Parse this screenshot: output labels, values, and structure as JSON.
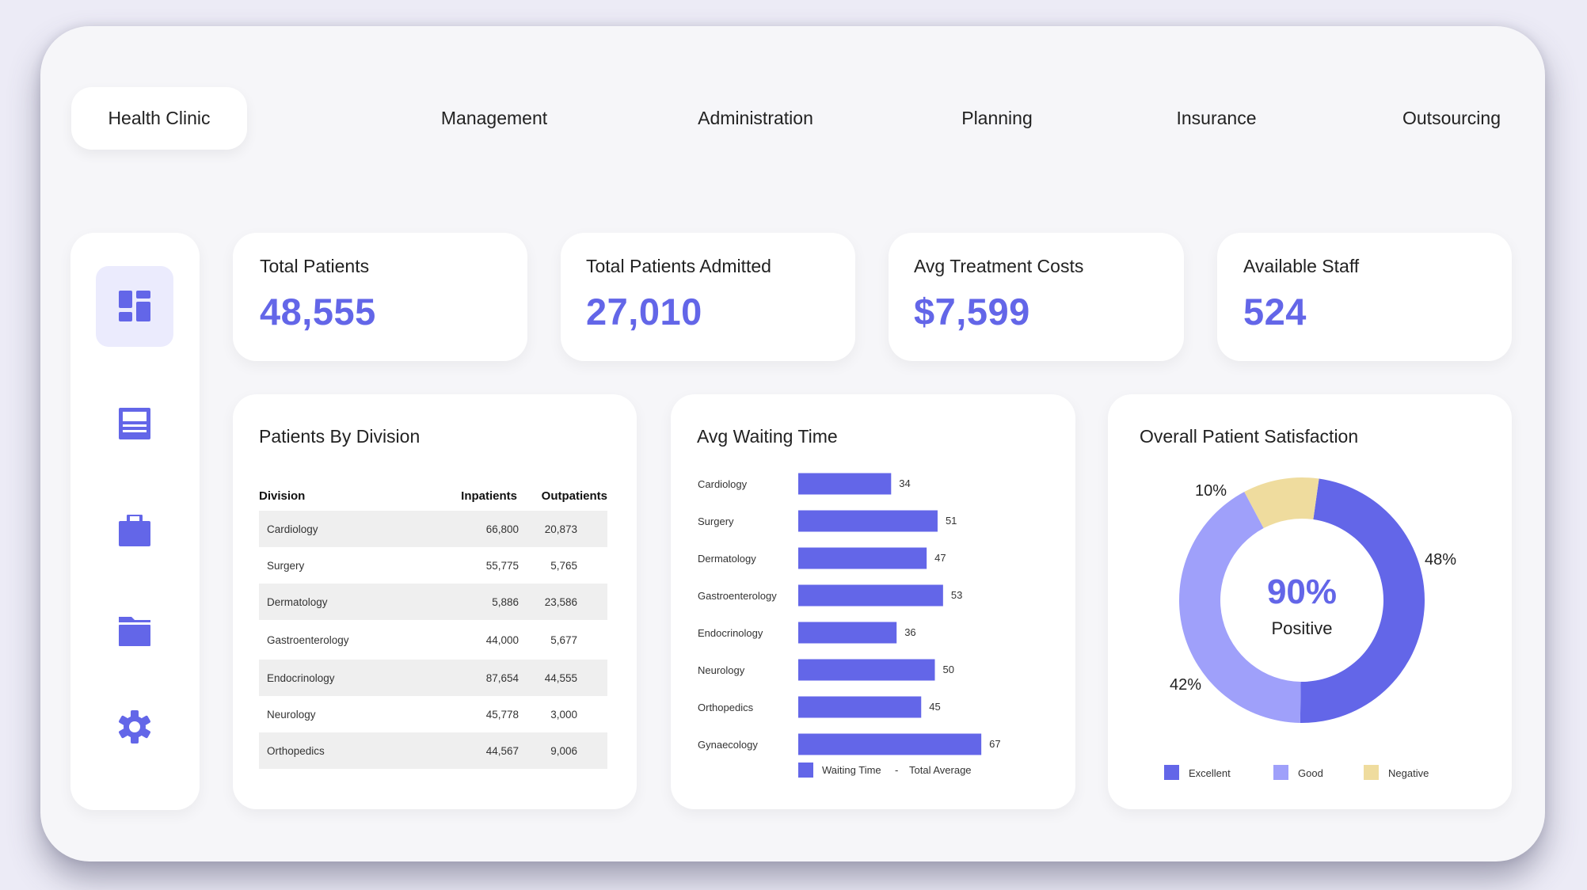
{
  "nav": {
    "brand": "Health Clinic",
    "items": [
      "Management",
      "Administration",
      "Planning",
      "Insurance",
      "Outsourcing"
    ]
  },
  "sidebar": {
    "items": [
      {
        "icon": "dashboard-icon",
        "active": true
      },
      {
        "icon": "document-list-icon",
        "active": false
      },
      {
        "icon": "briefcase-icon",
        "active": false
      },
      {
        "icon": "folder-icon",
        "active": false
      },
      {
        "icon": "gear-icon",
        "active": false
      }
    ]
  },
  "colors": {
    "accent": "#6366E8",
    "good": "#9FA0FA",
    "negative": "#EFDC9E",
    "row_shade": "#EFEFEF"
  },
  "kpis": [
    {
      "label": "Total Patients",
      "value": "48,555"
    },
    {
      "label": "Total Patients Admitted",
      "value": "27,010"
    },
    {
      "label": "Avg Treatment Costs",
      "value": "$7,599"
    },
    {
      "label": "Available Staff",
      "value": "524"
    }
  ],
  "division_table": {
    "title": "Patients By Division",
    "columns": [
      "Division",
      "Inpatients",
      "Outpatients"
    ],
    "rows": [
      [
        "Cardiology",
        "66,800",
        "20,873"
      ],
      [
        "Surgery",
        "55,775",
        "5,765"
      ],
      [
        "Dermatology",
        "5,886",
        "23,586"
      ],
      [
        "Gastroenterology",
        "44,000",
        "5,677"
      ],
      [
        "Endocrinology",
        "87,654",
        "44,555"
      ],
      [
        "Neurology",
        "45,778",
        "3,000"
      ],
      [
        "Orthopedics",
        "44,567",
        "9,006"
      ]
    ]
  },
  "chart_data": [
    {
      "type": "bar",
      "orientation": "horizontal",
      "title": "Avg Waiting Time",
      "categories": [
        "Cardiology",
        "Surgery",
        "Dermatology",
        "Gastroenterology",
        "Endocrinology",
        "Neurology",
        "Orthopedics",
        "Gynaecology"
      ],
      "series": [
        {
          "name": "Waiting Time",
          "values": [
            34,
            51,
            47,
            53,
            36,
            50,
            45,
            67
          ]
        }
      ],
      "legend": {
        "entries": [
          "Waiting Time",
          "Total Average"
        ],
        "separator": "-",
        "placement": "bottom"
      },
      "xlabel": "",
      "ylabel": "",
      "grid": false
    },
    {
      "type": "pie",
      "donut": true,
      "title": "Overall Patient Satisfaction",
      "center_value": "90%",
      "center_label": "Positive",
      "slices": [
        {
          "name": "Excellent",
          "value": 48,
          "label": "48%"
        },
        {
          "name": "Good",
          "value": 42,
          "label": "42%"
        },
        {
          "name": "Negative",
          "value": 10,
          "label": "10%"
        }
      ],
      "legend": {
        "entries": [
          "Excellent",
          "Good",
          "Negative"
        ],
        "placement": "bottom"
      }
    }
  ]
}
